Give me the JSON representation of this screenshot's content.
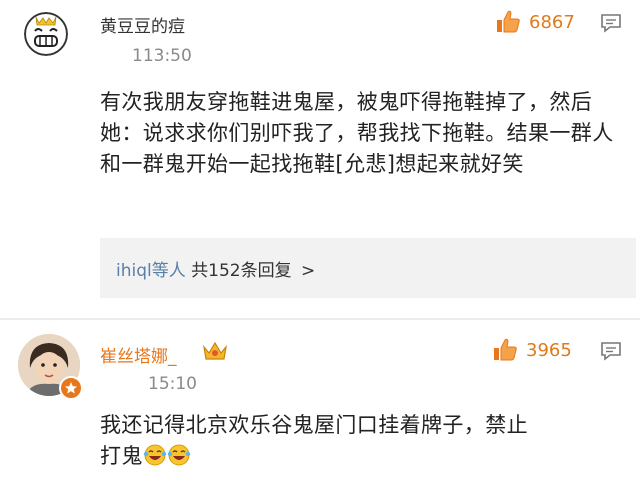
{
  "comments": [
    {
      "user": "黄豆豆的痘",
      "time": "113:50",
      "likes": "6867",
      "text": "有次我朋友穿拖鞋进鬼屋，被鬼吓得拖鞋掉了，然后她：说求求你们别吓我了，帮我找下拖鞋。结果一群人和一群鬼开始一起找拖鞋[允悲]想起来就好笑",
      "reply_user": "ihiql等人",
      "reply_count": "共152条回复",
      "reply_arrow": ">"
    },
    {
      "user": "崔丝塔娜_",
      "time": "15:10",
      "likes": "3965",
      "text": "我还记得北京欢乐谷鬼屋门口挂着牌子，禁止打鬼"
    }
  ],
  "icons": {
    "like": "thumbs-up-icon",
    "comment": "comment-bubble-icon",
    "badge": "crown-badge-icon",
    "emoji": "laughing-tears-emoji"
  },
  "colors": {
    "accent_orange": "#e8761b",
    "link_blue": "#5a7fa8",
    "time_gray": "#8a8a8a"
  }
}
